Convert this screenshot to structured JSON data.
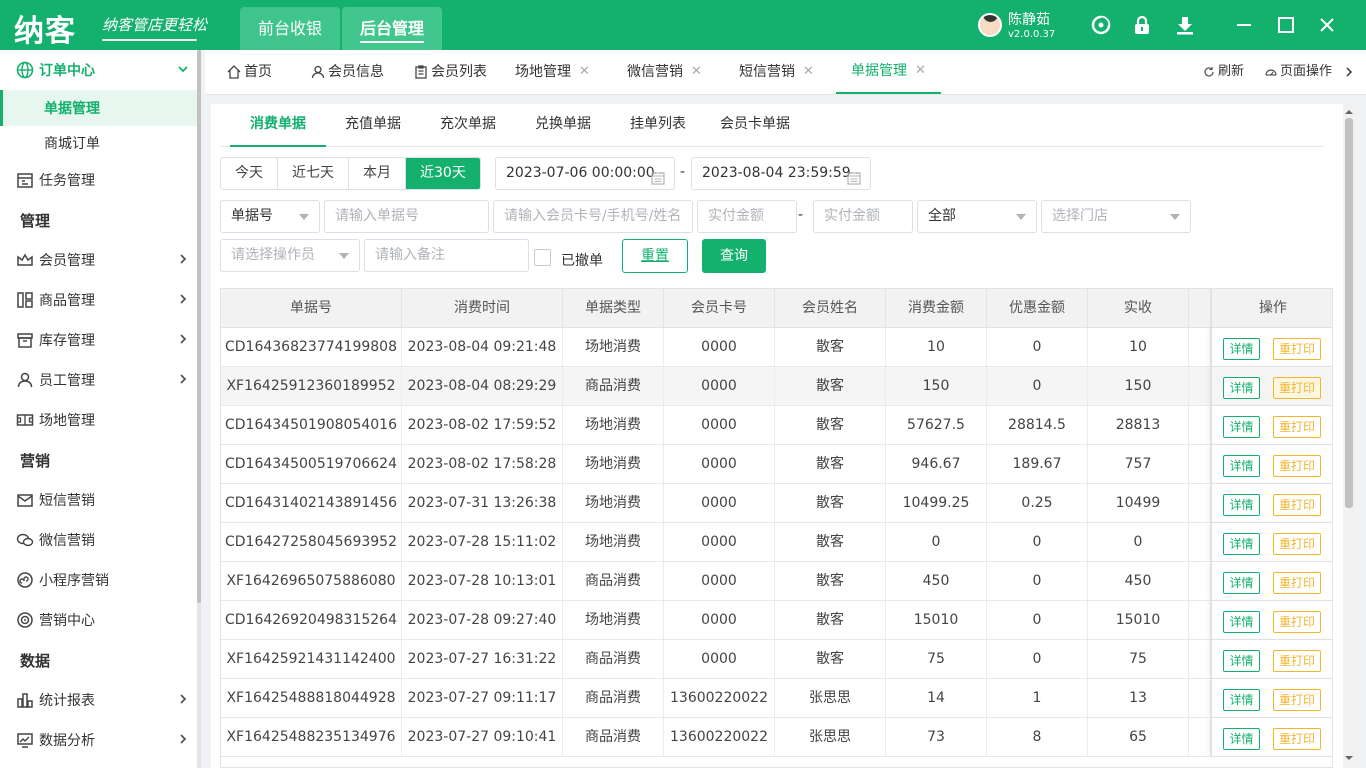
{
  "app": {
    "logo": "纳客",
    "slogan": "纳客管店更轻松",
    "nav": [
      "前台收银",
      "后台管理"
    ],
    "user_name": "陈静茹",
    "version": "v2.0.0.37"
  },
  "sidebar": {
    "order_center": "订单中心",
    "receipt_mgmt": "单据管理",
    "mall_orders": "商城订单",
    "task_mgmt": "任务管理",
    "section_manage": "管理",
    "member_mgmt": "会员管理",
    "goods_mgmt": "商品管理",
    "stock_mgmt": "库存管理",
    "staff_mgmt": "员工管理",
    "venue_mgmt": "场地管理",
    "section_marketing": "营销",
    "sms_marketing": "短信营销",
    "wechat_marketing": "微信营销",
    "miniapp_marketing": "小程序营销",
    "marketing_center": "营销中心",
    "section_data": "数据",
    "reports": "统计报表",
    "analysis": "数据分析"
  },
  "tabs": {
    "home": "首页",
    "member_info": "会员信息",
    "member_list": "会员列表",
    "venue": "场地管理",
    "wechat": "微信营销",
    "sms": "短信营销",
    "receipt": "单据管理",
    "refresh": "刷新",
    "page_ops": "页面操作"
  },
  "subtabs": [
    "消费单据",
    "充值单据",
    "充次单据",
    "兑换单据",
    "挂单列表",
    "会员卡单据"
  ],
  "filters": {
    "quick": [
      "今天",
      "近七天",
      "本月",
      "近30天"
    ],
    "start_date": "2023-07-06 00:00:00",
    "end_date": "2023-08-04 23:59:59",
    "receipt_type": "单据号",
    "receipt_ph": "请输入单据号",
    "member_ph": "请输入会员卡号/手机号/姓名",
    "amount_min_ph": "实付金额",
    "amount_max_ph": "实付金额",
    "status": "全部",
    "store_ph": "选择门店",
    "operator_ph": "请选择操作员",
    "remark_ph": "请输入备注",
    "revoked": "已撤单",
    "reset": "重置",
    "query": "查询",
    "dash": "-"
  },
  "table": {
    "headers": [
      "单据号",
      "消费时间",
      "单据类型",
      "会员卡号",
      "会员姓名",
      "消费金额",
      "优惠金额",
      "实收",
      "操作"
    ],
    "detail_btn": "详情",
    "reprint_btn": "重打印",
    "rows": [
      [
        "CD16436823774199808",
        "2023-08-04 09:21:48",
        "场地消费",
        "0000",
        "散客",
        "10",
        "0",
        "10"
      ],
      [
        "XF16425912360189952",
        "2023-08-04 08:29:29",
        "商品消费",
        "0000",
        "散客",
        "150",
        "0",
        "150"
      ],
      [
        "CD16434501908054016",
        "2023-08-02 17:59:52",
        "场地消费",
        "0000",
        "散客",
        "57627.5",
        "28814.5",
        "28813"
      ],
      [
        "CD16434500519706624",
        "2023-08-02 17:58:28",
        "场地消费",
        "0000",
        "散客",
        "946.67",
        "189.67",
        "757"
      ],
      [
        "CD16431402143891456",
        "2023-07-31 13:26:38",
        "场地消费",
        "0000",
        "散客",
        "10499.25",
        "0.25",
        "10499"
      ],
      [
        "CD16427258045693952",
        "2023-07-28 15:11:02",
        "场地消费",
        "0000",
        "散客",
        "0",
        "0",
        "0"
      ],
      [
        "XF16426965075886080",
        "2023-07-28 10:13:01",
        "商品消费",
        "0000",
        "散客",
        "450",
        "0",
        "450"
      ],
      [
        "CD16426920498315264",
        "2023-07-28 09:27:40",
        "场地消费",
        "0000",
        "散客",
        "15010",
        "0",
        "15010"
      ],
      [
        "XF16425921431142400",
        "2023-07-27 16:31:22",
        "商品消费",
        "0000",
        "散客",
        "75",
        "0",
        "75"
      ],
      [
        "XF16425488818044928",
        "2023-07-27 09:11:17",
        "商品消费",
        "13600220022",
        "张思思",
        "14",
        "1",
        "13"
      ],
      [
        "XF16425488235134976",
        "2023-07-27 09:10:41",
        "商品消费",
        "13600220022",
        "张思思",
        "73",
        "8",
        "65"
      ]
    ]
  }
}
